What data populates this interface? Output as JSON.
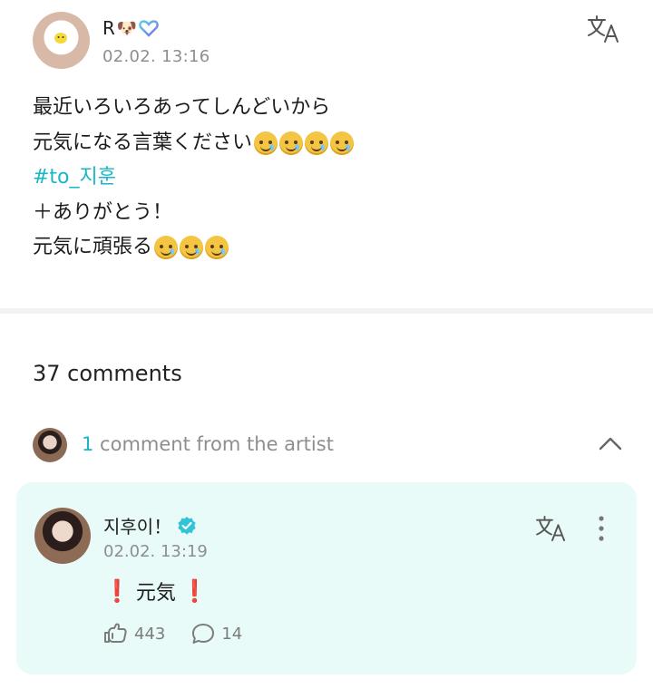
{
  "post": {
    "username": "R",
    "username_emoji": "🐶",
    "time": "02.02. 13:16",
    "lines": {
      "l1": "最近いろいろあってしんどいから",
      "l2": "元気になる言葉ください",
      "l3": "#to_지훈",
      "l4": "＋ありがとう！",
      "l5": "元気に頑張る"
    }
  },
  "comments_count": "37 comments",
  "artist_comments": {
    "count": "1",
    "label": " comment from the artist"
  },
  "artist_comment": {
    "name": "지후이！",
    "time": "02.02. 13:19",
    "body_mark_left": "❗",
    "body_text": "元気",
    "body_mark_right": "❗",
    "likes": "443",
    "replies": "14"
  },
  "colors": {
    "accent": "#19b6c6",
    "card_bg": "#e8fbf8",
    "muted_text": "#8e8e8e"
  },
  "icons": {
    "translate": "translate-icon",
    "more": "more-vertical-icon",
    "chevron": "chevron-up-icon",
    "like": "like-hand-icon",
    "reply": "speech-bubble-icon",
    "verified": "verified-badge-icon"
  }
}
